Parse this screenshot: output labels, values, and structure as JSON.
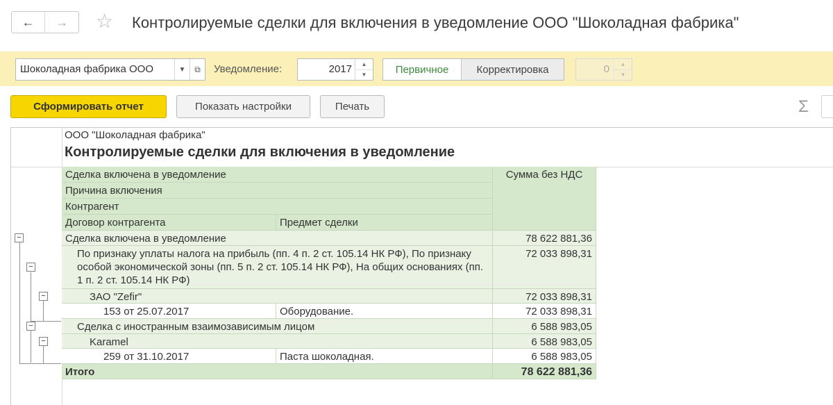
{
  "window": {
    "title": "Контролируемые сделки для включения в уведомление ООО \"Шоколадная фабрика\"",
    "back_icon": "←",
    "forward_icon": "→",
    "favorite_icon": "☆"
  },
  "settings": {
    "organization_value": "Шоколадная фабрика ООО",
    "notice_label": "Уведомление:",
    "year_value": "2017",
    "type_primary": "Первичное",
    "type_correction": "Корректировка",
    "correction_number": "0"
  },
  "toolbar": {
    "generate_label": "Сформировать отчет",
    "settings_label": "Показать настройки",
    "print_label": "Печать",
    "sum_icon": "Σ"
  },
  "report": {
    "org_name": "ООО \"Шоколадная фабрика\"",
    "title": "Контролируемые сделки для включения в уведомление",
    "headers": {
      "deal_included": "Сделка включена в уведомление",
      "reason": "Причина включения",
      "counterparty": "Контрагент",
      "contract": "Договор контрагента",
      "subject": "Предмет сделки",
      "amount": "Сумма без НДС"
    },
    "rows": {
      "group": {
        "label": "Сделка включена в уведомление",
        "amount": "78 622 881,36"
      },
      "reason1": {
        "label": "По признаку уплаты налога на прибыль (пп. 4 п. 2 ст. 105.14 НК РФ), По признаку особой экономической зоны (пп. 5 п. 2 ст. 105.14 НК РФ), На общих основаниях (пп. 1 п. 2 ст. 105.14 НК РФ)",
        "amount": "72 033 898,31"
      },
      "cp1": {
        "label": "ЗАО \"Zefir\"",
        "amount": "72 033 898,31"
      },
      "contract1": {
        "label": "153 от 25.07.2017",
        "subject": "Оборудование.",
        "amount": "72 033 898,31"
      },
      "reason2": {
        "label": "Сделка с иностранным взаимозависимым лицом",
        "amount": "6 588 983,05"
      },
      "cp2": {
        "label": "Karamel",
        "amount": "6 588 983,05"
      },
      "contract2": {
        "label": "259 от 31.10.2017",
        "subject": "Паста шоколадная.",
        "amount": "6 588 983,05"
      },
      "total": {
        "label": "Итого",
        "amount": "78 622 881,36"
      }
    }
  }
}
